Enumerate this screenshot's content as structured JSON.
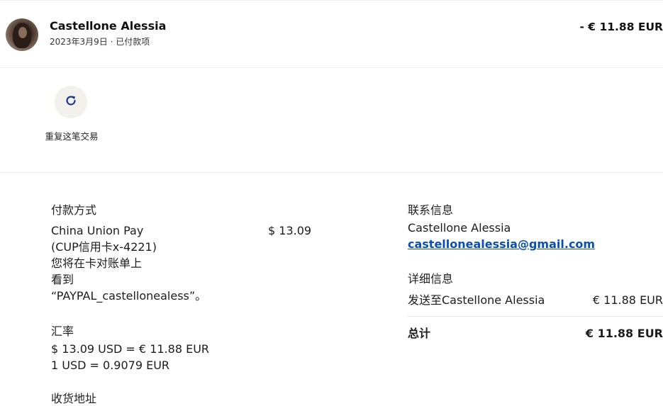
{
  "transaction": {
    "name": "Castellone Alessia",
    "date_status": "2023年3月9日 · 已付款项",
    "amount": "- € 11.88 EUR"
  },
  "actions": {
    "repeat_label": "重复这笔交易"
  },
  "payment": {
    "title": "付款方式",
    "method_line1": "China Union Pay",
    "method_line2": "(CUP信用卡x-4221)",
    "method_line3": "您将在卡对账单上",
    "method_line4": "看到",
    "method_line5": "“PAYPAL_castellonealess”。",
    "amount": "$ 13.09"
  },
  "exchange": {
    "title": "汇率",
    "line1": "$ 13.09 USD = € 11.88 EUR",
    "line2": "1 USD = 0.9079 EUR"
  },
  "address": {
    "title": "收货地址"
  },
  "contact": {
    "title": "联系信息",
    "name": "Castellone Alessia",
    "email": "castellonealessia@gmail.com"
  },
  "details": {
    "title": "详细信息",
    "sent_to_label": "发送至Castellone Alessia",
    "sent_to_amount": "€ 11.88 EUR",
    "total_label": "总计",
    "total_amount": "€ 11.88 EUR"
  },
  "icons": {
    "repeat": "refresh-icon"
  },
  "colors": {
    "link": "#0b4fb3",
    "icon_blue": "#1b3a8c",
    "button_bg": "#f2f1ec"
  }
}
